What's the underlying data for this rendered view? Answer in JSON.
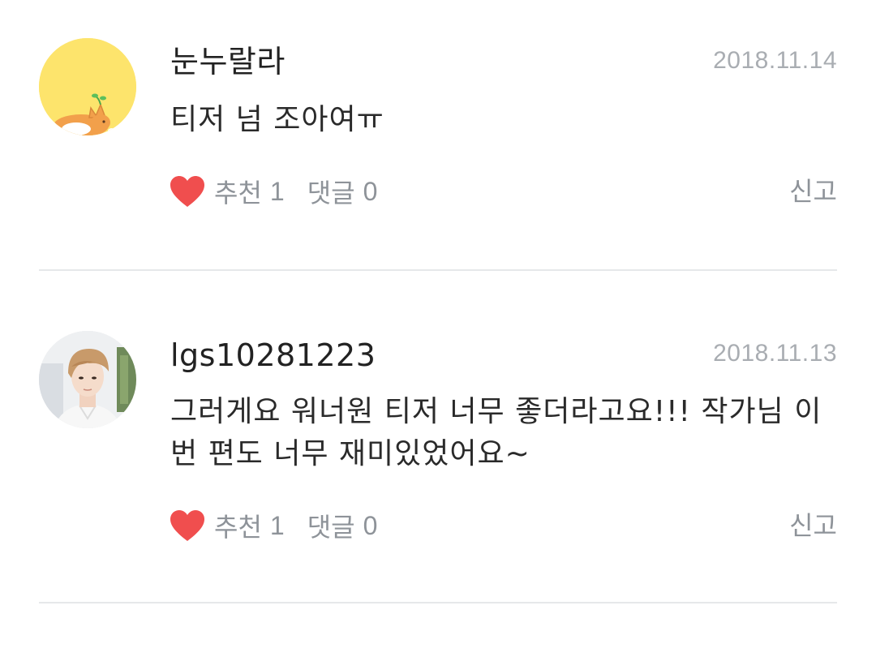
{
  "comments": [
    {
      "author": "눈누랄라",
      "date": "2018.11.14",
      "text": "티저 넘 조아여ㅠ",
      "like_label": "추천",
      "like_count": "1",
      "reply_label": "댓글",
      "reply_count": "0",
      "report_label": "신고",
      "avatar_icon": "corgi-character-avatar"
    },
    {
      "author": "lgs10281223",
      "date": "2018.11.13",
      "text": "그러게요 워너원 티저 너무 좋더라고요!!! 작가님 이번 편도 너무 재미있었어요~",
      "like_label": "추천",
      "like_count": "1",
      "reply_label": "댓글",
      "reply_count": "0",
      "report_label": "신고",
      "avatar_icon": "person-photo-avatar"
    }
  ],
  "colors": {
    "heart": "#f04e4e",
    "meta_text": "#8e9399",
    "date_text": "#a9adb2",
    "divider": "#e6e8ea"
  }
}
